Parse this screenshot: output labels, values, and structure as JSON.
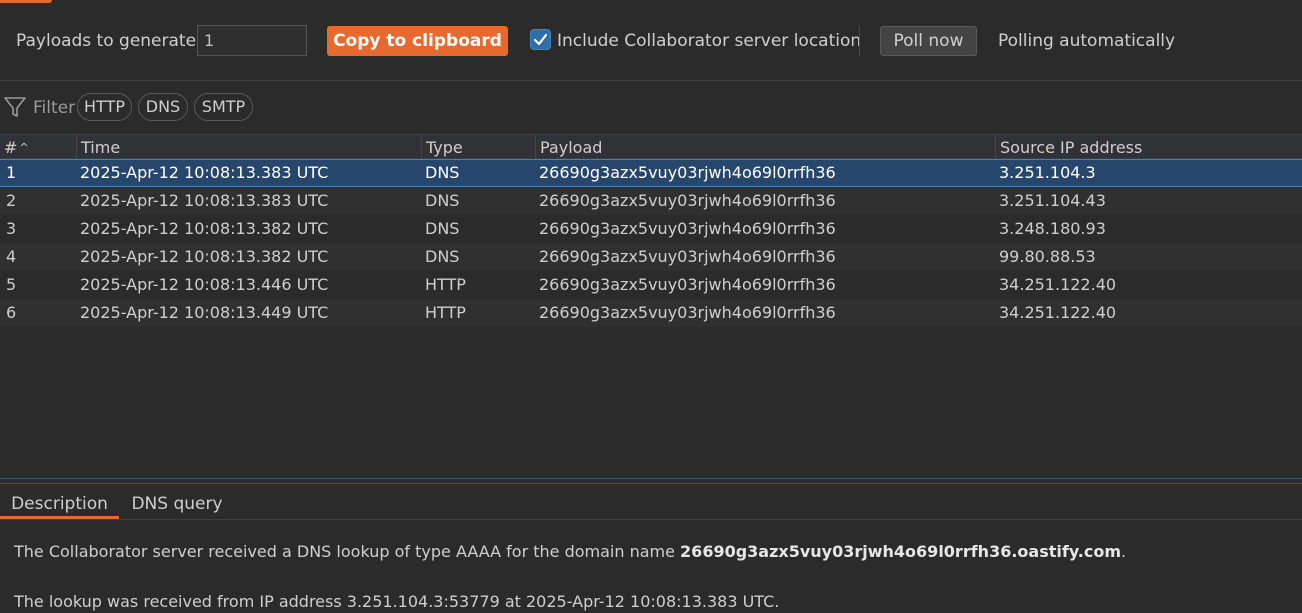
{
  "toolbar": {
    "payloads_label": "Payloads to generate:",
    "payloads_value": "1",
    "copy_label": "Copy to clipboard",
    "include_location_label": "Include Collaborator server location",
    "include_location_checked": true,
    "poll_label": "Poll now",
    "polling_status": "Polling automatically"
  },
  "filter": {
    "label": "Filter",
    "chips": [
      "HTTP",
      "DNS",
      "SMTP"
    ]
  },
  "table": {
    "columns": [
      "#",
      "Time",
      "Type",
      "Payload",
      "Source IP address"
    ],
    "sorted_column": "#",
    "rows": [
      {
        "num": "1",
        "time": "2025-Apr-12 10:08:13.383 UTC",
        "type": "DNS",
        "payload": "26690g3azx5vuy03rjwh4o69l0rrfh36",
        "ip": "3.251.104.3",
        "selected": true
      },
      {
        "num": "2",
        "time": "2025-Apr-12 10:08:13.383 UTC",
        "type": "DNS",
        "payload": "26690g3azx5vuy03rjwh4o69l0rrfh36",
        "ip": "3.251.104.43"
      },
      {
        "num": "3",
        "time": "2025-Apr-12 10:08:13.382 UTC",
        "type": "DNS",
        "payload": "26690g3azx5vuy03rjwh4o69l0rrfh36",
        "ip": "3.248.180.93"
      },
      {
        "num": "4",
        "time": "2025-Apr-12 10:08:13.382 UTC",
        "type": "DNS",
        "payload": "26690g3azx5vuy03rjwh4o69l0rrfh36",
        "ip": "99.80.88.53"
      },
      {
        "num": "5",
        "time": "2025-Apr-12 10:08:13.446 UTC",
        "type": "HTTP",
        "payload": "26690g3azx5vuy03rjwh4o69l0rrfh36",
        "ip": "34.251.122.40"
      },
      {
        "num": "6",
        "time": "2025-Apr-12 10:08:13.449 UTC",
        "type": "HTTP",
        "payload": "26690g3azx5vuy03rjwh4o69l0rrfh36",
        "ip": "34.251.122.40"
      }
    ]
  },
  "detail": {
    "tabs": [
      "Description",
      "DNS query"
    ],
    "active_tab": "Description",
    "line1_prefix": "The Collaborator server received a DNS lookup of type AAAA for the domain name ",
    "line1_domain": "26690g3azx5vuy03rjwh4o69l0rrfh36.oastify.com",
    "line1_suffix": ".",
    "line2": "The lookup was received from IP address 3.251.104.3:53779 at 2025-Apr-12 10:08:13.383 UTC."
  },
  "colors": {
    "accent": "#e8692d",
    "selection": "#26476b",
    "background": "#2b2b2b"
  },
  "icons": {
    "filter": "filter-icon",
    "sort": "sort-ascending-icon",
    "checkbox": "checkmark-icon"
  }
}
